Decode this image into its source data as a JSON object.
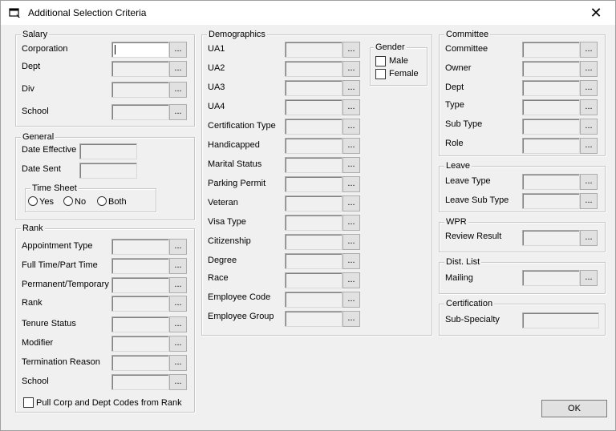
{
  "window": {
    "title": "Additional Selection Criteria",
    "close_glyph": "✕"
  },
  "salary": {
    "label": "Salary",
    "rows": [
      "Corporation",
      "Dept",
      "Div",
      "School"
    ]
  },
  "general": {
    "label": "General",
    "rows": [
      "Date Effective",
      "Date Sent"
    ],
    "timesheet": {
      "label": "Time Sheet",
      "options": [
        "Yes",
        "No",
        "Both"
      ]
    }
  },
  "rank": {
    "label": "Rank",
    "rows": [
      "Appointment Type",
      "Full Time/Part Time",
      "Permanent/Temporary",
      "Rank",
      "Tenure Status",
      "Modifier",
      "Termination Reason",
      "School"
    ],
    "checkbox_label": "Pull Corp and Dept Codes from Rank"
  },
  "demographics": {
    "label": "Demographics",
    "rows": [
      "UA1",
      "UA2",
      "UA3",
      "UA4",
      "Certification Type",
      "Handicapped",
      "Marital Status",
      "Parking Permit",
      "Veteran",
      "Visa Type",
      "Citizenship",
      "Degree",
      "Race",
      "Employee Code",
      "Employee Group"
    ]
  },
  "gender": {
    "label": "Gender",
    "options": [
      "Male",
      "Female"
    ]
  },
  "committee": {
    "label": "Committee",
    "rows": [
      "Committee",
      "Owner",
      "Dept",
      "Type",
      "Sub Type",
      "Role"
    ]
  },
  "leave": {
    "label": "Leave",
    "rows": [
      "Leave Type",
      "Leave Sub Type"
    ]
  },
  "wpr": {
    "label": "WPR",
    "rows": [
      "Review Result"
    ]
  },
  "dist_list": {
    "label": "Dist. List",
    "rows": [
      "Mailing"
    ]
  },
  "certification": {
    "label": "Certification",
    "rows": [
      "Sub-Specialty"
    ]
  },
  "browse_label": "...",
  "ok_label": "OK"
}
